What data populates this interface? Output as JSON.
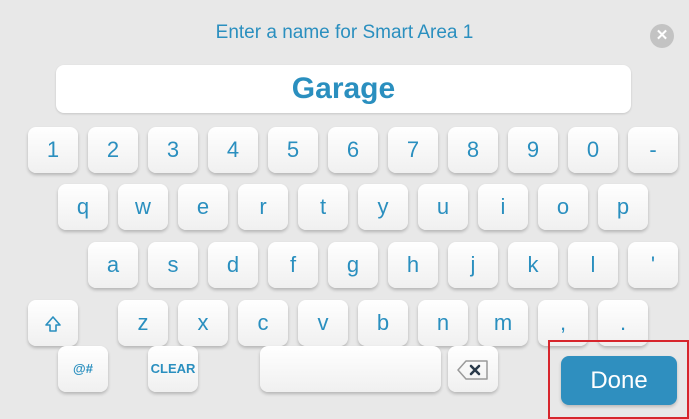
{
  "dialog": {
    "title": "Enter a name for Smart Area 1",
    "name_value": "Garage",
    "close_icon": "close-icon"
  },
  "keyboard": {
    "row1": [
      "1",
      "2",
      "3",
      "4",
      "5",
      "6",
      "7",
      "8",
      "9",
      "0",
      "-"
    ],
    "row2": [
      "q",
      "w",
      "e",
      "r",
      "t",
      "y",
      "u",
      "i",
      "o",
      "p"
    ],
    "row3": [
      "a",
      "s",
      "d",
      "f",
      "g",
      "h",
      "j",
      "k",
      "l",
      "'"
    ],
    "row4": [
      "z",
      "x",
      "c",
      "v",
      "b",
      "n",
      "m",
      ",",
      "."
    ],
    "shift_icon": "shift-icon",
    "symbols_label": "@#",
    "clear_label": "CLEAR",
    "backspace_icon": "backspace-icon",
    "done_label": "Done"
  },
  "colors": {
    "accent": "#2a8fbf",
    "highlight": "#d7252c",
    "background": "#e8e8e8"
  }
}
